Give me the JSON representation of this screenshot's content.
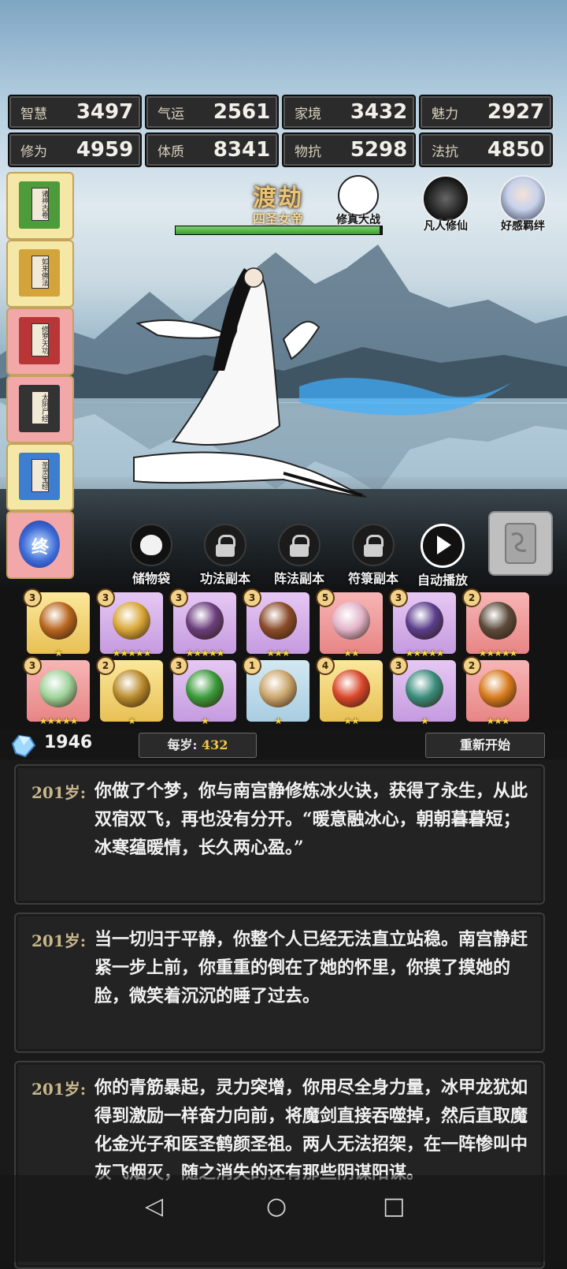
{
  "stats": [
    {
      "label": "智慧",
      "value": "3497"
    },
    {
      "label": "气运",
      "value": "2561"
    },
    {
      "label": "家境",
      "value": "3432"
    },
    {
      "label": "魅力",
      "value": "2927"
    },
    {
      "label": "修为",
      "value": "4959"
    },
    {
      "label": "体质",
      "value": "8341"
    },
    {
      "label": "物抗",
      "value": "5298"
    },
    {
      "label": "法抗",
      "value": "4850"
    }
  ],
  "books": [
    {
      "title": "诸神古卷",
      "color": "#4d9b3b",
      "bg": "#f5e7a6"
    },
    {
      "title": "如来佛法",
      "color": "#d3a43a",
      "bg": "#f5e7a6"
    },
    {
      "title": "修罗天功",
      "color": "#b93636",
      "bg": "#f2a8a8"
    },
    {
      "title": "太阴尸经",
      "color": "#333333",
      "bg": "#f2a8a8"
    },
    {
      "title": "圣灵宝经",
      "color": "#3d7ed1",
      "bg": "#f5e7a6"
    },
    {
      "title": "终",
      "color": "#2a4fb8",
      "bg": "#f2a8a8"
    }
  ],
  "realm": {
    "name": "渡劫",
    "subtitle": "四圣女帝",
    "progress": 0.99
  },
  "top_buttons": [
    {
      "label": "修真大战",
      "icon": "meditation-icon"
    },
    {
      "label": "凡人修仙",
      "icon": "immortal-icon"
    },
    {
      "label": "好感羁绊",
      "icon": "girl-portrait-icon"
    }
  ],
  "actions": [
    {
      "label": "储物袋",
      "icon": "bag-icon",
      "locked": false
    },
    {
      "label": "功法副本",
      "icon": "lock-icon",
      "locked": true
    },
    {
      "label": "阵法副本",
      "icon": "lock-icon",
      "locked": true
    },
    {
      "label": "符箓副本",
      "icon": "lock-icon",
      "locked": true
    },
    {
      "label": "自动播放",
      "icon": "play-icon",
      "locked": false
    }
  ],
  "items": [
    {
      "level": "3",
      "stars": "★",
      "color": "gold",
      "icon": "fan-crossbow-icon",
      "hue": "#b8661e"
    },
    {
      "level": "3",
      "stars": "★★★★★",
      "color": "purp",
      "icon": "mirror-icon",
      "hue": "#d9a637"
    },
    {
      "level": "3",
      "stars": "★★★★★",
      "color": "purp",
      "icon": "crossbow-icon",
      "hue": "#6b3e7c"
    },
    {
      "level": "3",
      "stars": "★★★",
      "color": "purp",
      "icon": "sword-icon",
      "hue": "#8a4b2a"
    },
    {
      "level": "5",
      "stars": "★★",
      "color": "red",
      "icon": "scroll-icon",
      "hue": "#e2b3c9"
    },
    {
      "level": "3",
      "stars": "★★★★★",
      "color": "purp",
      "icon": "ring-icon",
      "hue": "#5a3e8c"
    },
    {
      "level": "2",
      "stars": "★★★★★",
      "color": "red",
      "icon": "hammer-icon",
      "hue": "#5b4a3a"
    },
    {
      "level": "3",
      "stars": "★★★★★",
      "color": "red",
      "icon": "jade-seal-icon",
      "hue": "#9fd39a"
    },
    {
      "level": "2",
      "stars": "★",
      "color": "gold",
      "icon": "dragon-ring-icon",
      "hue": "#b98a2c"
    },
    {
      "level": "3",
      "stars": "★",
      "color": "purp",
      "icon": "green-claw-icon",
      "hue": "#3b9a3b"
    },
    {
      "level": "1",
      "stars": "★",
      "color": "blue",
      "icon": "fan-icon",
      "hue": "#caa56b"
    },
    {
      "level": "4",
      "stars": "★★",
      "color": "gold",
      "icon": "fire-boot-icon",
      "hue": "#d9462a"
    },
    {
      "level": "3",
      "stars": "★",
      "color": "purp",
      "icon": "jade-hammer-icon",
      "hue": "#3a8c7c"
    },
    {
      "level": "2",
      "stars": "★★★",
      "color": "red",
      "icon": "cauldron-icon",
      "hue": "#d77a1e"
    }
  ],
  "resources": {
    "spirit_stones": "1946",
    "per_year_label": "每岁:",
    "per_year_value": "432",
    "restart_label": "重新开始"
  },
  "log": [
    {
      "age": "201岁:",
      "text": "你做了个梦，你与南宫静修炼冰火诀，获得了永生，从此双宿双飞，再也没有分开。“暖意融冰心，朝朝暮暮短；冰寒蕴暖情，长久两心盈。”"
    },
    {
      "age": "201岁:",
      "text": "当一切归于平静，你整个人已经无法直立站稳。南宫静赶紧一步上前，你重重的倒在了她的怀里，你摸了摸她的脸，微笑着沉沉的睡了过去。"
    },
    {
      "age": "201岁:",
      "text": "你的青筋暴起，灵力突增，你用尽全身力量，冰甲龙犹如得到激励一样奋力向前，将魔剑直接吞噬掉，然后直取魔化金光子和医圣鹤颜圣祖。两人无法招架，在一阵惨叫中灰飞烟灭，随之消失的还有那些阴谋阳谋。"
    }
  ],
  "nav": {
    "back": "◁",
    "home": "○",
    "recent": "□"
  }
}
